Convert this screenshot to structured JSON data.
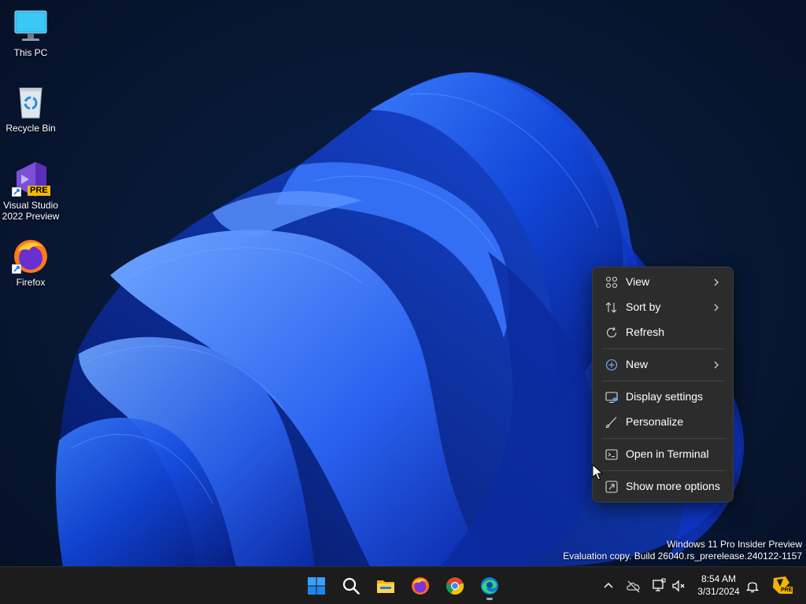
{
  "desktop": {
    "icons": [
      {
        "label": "This PC",
        "icon": "monitor-icon"
      },
      {
        "label": "Recycle Bin",
        "icon": "recycle-bin-icon"
      },
      {
        "label_line1": "Visual Studio",
        "label_line2": "2022 Preview",
        "badge": "PRE",
        "icon": "visual-studio-icon"
      },
      {
        "label": "Firefox",
        "icon": "firefox-icon"
      }
    ]
  },
  "context_menu": {
    "items": [
      {
        "label": "View",
        "icon": "grid-icon",
        "submenu": true
      },
      {
        "label": "Sort by",
        "icon": "sort-icon",
        "submenu": true
      },
      {
        "label": "Refresh",
        "icon": "refresh-icon",
        "submenu": false
      },
      {
        "label": "New",
        "icon": "plus-circle-icon",
        "submenu": true
      },
      {
        "label": "Display settings",
        "icon": "display-settings-icon",
        "submenu": false
      },
      {
        "label": "Personalize",
        "icon": "brush-icon",
        "submenu": false
      },
      {
        "label": "Open in Terminal",
        "icon": "terminal-icon",
        "submenu": false
      },
      {
        "label": "Show more options",
        "icon": "more-options-icon",
        "submenu": false
      }
    ]
  },
  "watermark": {
    "line1": "Windows 11 Pro Insider Preview",
    "line2": "Evaluation copy. Build 26040.rs_prerelease.240122-1157"
  },
  "taskbar": {
    "apps": [
      "start-icon",
      "search-icon",
      "file-explorer-icon",
      "firefox-icon",
      "chrome-icon",
      "edge-icon"
    ],
    "clock": {
      "time": "8:54 AM",
      "date": "3/31/2024"
    },
    "tray_badge": "PRE"
  },
  "colors": {
    "accent": "#1a6fe0",
    "menu_bg": "#2c2c2c",
    "taskbar_bg": "#1c1c1c"
  }
}
